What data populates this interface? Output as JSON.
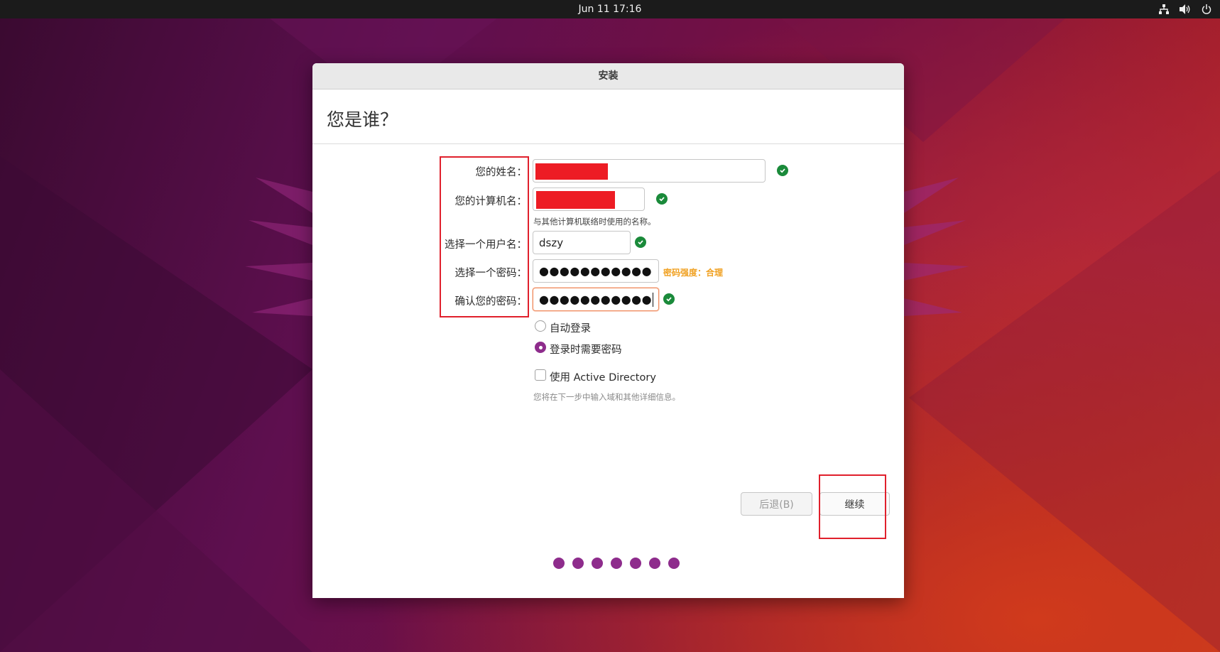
{
  "topbar": {
    "clock": "Jun 11  17:16",
    "tray_icons": [
      "network-icon",
      "volume-icon",
      "power-icon"
    ]
  },
  "window": {
    "title": "安装",
    "heading": "您是谁？"
  },
  "form": {
    "name_label": "您的姓名：",
    "computer_label": "您的计算机名：",
    "computer_hint": "与其他计算机联络时使用的名称。",
    "username_label": "选择一个用户名：",
    "username_value": "dszy",
    "password_label": "选择一个密码：",
    "password_value": "●●●●●●●●●●●",
    "password_strength": "密码强度：合理",
    "confirm_label": "确认您的密码：",
    "confirm_value": "●●●●●●●●●●●"
  },
  "login": {
    "auto_login": "自动登录",
    "require_password": "登录时需要密码",
    "selected": "require_password",
    "active_directory": "使用 Active Directory",
    "active_directory_checked": false,
    "ad_hint": "您将在下一步中输入域和其他详细信息。"
  },
  "buttons": {
    "back": "后退(B)",
    "continue": "继续"
  },
  "colors": {
    "accent": "#8e2c8c",
    "ok_green": "#1a8a3a",
    "strength_orange": "#f0a020",
    "focus_orange": "#f08a5d",
    "annotation_red": "#e0202c"
  },
  "progress": {
    "steps_total": 7
  }
}
